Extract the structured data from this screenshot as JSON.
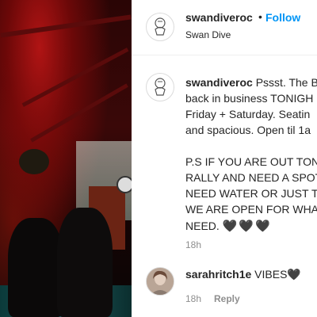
{
  "post": {
    "username": "swandiveroc",
    "separator": "•",
    "follow_label": "Follow",
    "location": "Swan Dive"
  },
  "caption": {
    "username": "swandiveroc",
    "lines": [
      "Pssst. The B",
      "back in business TONIGH",
      "Friday + Saturday. Seatin",
      "and spacious. Open til 1a",
      "",
      "P.S IF YOU ARE OUT TON",
      "RALLY AND NEED A SPOT",
      "NEED WATER OR JUST TO",
      "WE ARE OPEN FOR WHAT",
      "NEED."
    ],
    "hearts": "🖤🖤🖤",
    "time": "18h"
  },
  "comment": {
    "username": "sarahritch1e",
    "text": "VIBES",
    "heart": "🖤",
    "time": "18h",
    "reply_label": "Reply"
  },
  "colors": {
    "link_blue": "#0095f6",
    "text": "#262626",
    "muted": "#8e8e8e"
  }
}
